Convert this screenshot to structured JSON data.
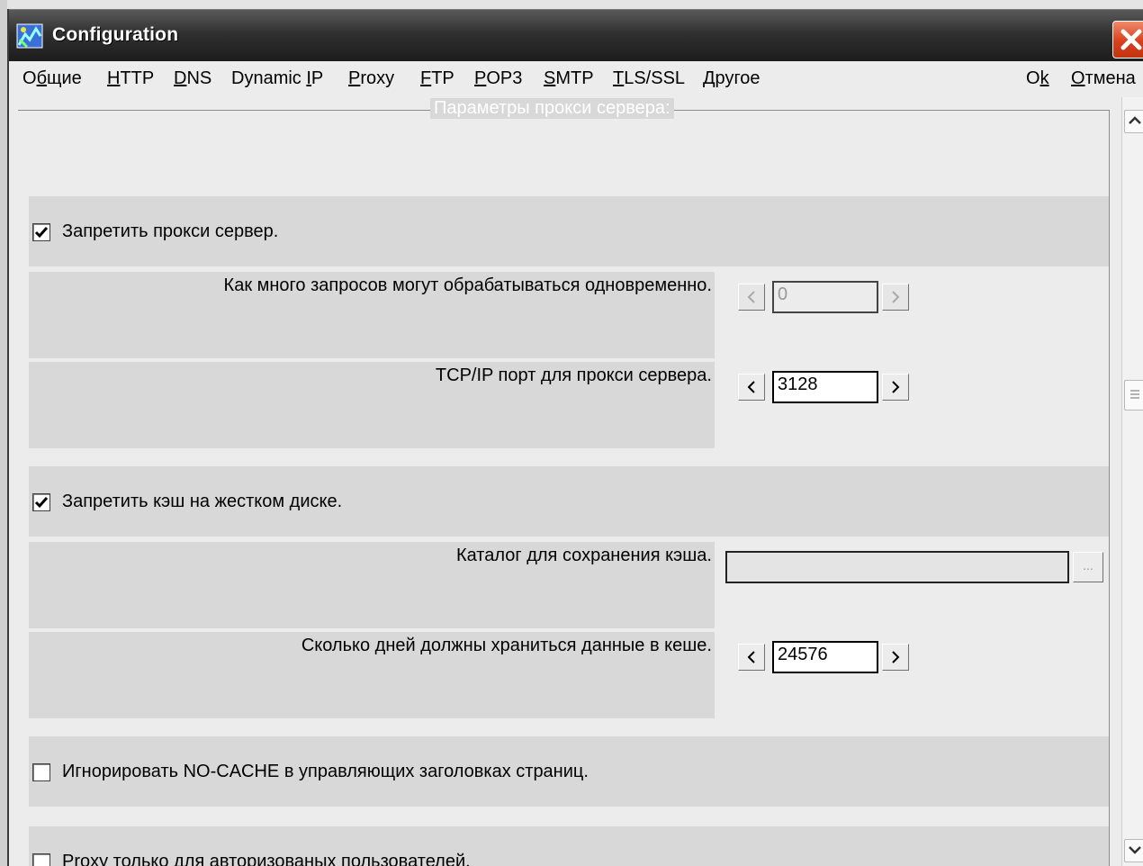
{
  "window": {
    "title": "Configuration",
    "icon": "config-app-icon",
    "close_icon": "close-icon"
  },
  "menu": {
    "items": [
      {
        "pre": "О",
        "key": "б",
        "post": "щие"
      },
      {
        "pre": "",
        "key": "H",
        "post": "TTP"
      },
      {
        "pre": "",
        "key": "D",
        "post": "NS"
      },
      {
        "pre": "Dynamic ",
        "key": "I",
        "post": "P"
      },
      {
        "pre": "",
        "key": "P",
        "post": "roxy"
      },
      {
        "pre": "",
        "key": "F",
        "post": "TP"
      },
      {
        "pre": "",
        "key": "P",
        "post": "OP3"
      },
      {
        "pre": "",
        "key": "S",
        "post": "MTP"
      },
      {
        "pre": "",
        "key": "T",
        "post": "LS/SSL"
      },
      {
        "pre": "",
        "key": "Д",
        "post": "ругое"
      }
    ],
    "ok": {
      "pre": "O",
      "key": "k",
      "post": ""
    },
    "cancel": {
      "pre": "",
      "key": "О",
      "post": "тмена"
    }
  },
  "group": {
    "title": "Параметры прокси сервера:"
  },
  "options": {
    "disable_proxy": {
      "label": "Запретить прокси сервер.",
      "checked": true
    },
    "concurrent_requests": {
      "label": "Как много запросов могут обрабатываться одновременно.",
      "value": "0",
      "enabled": false
    },
    "proxy_port": {
      "label": "TCP/IP порт для прокси сервера.",
      "value": "3128",
      "enabled": true
    },
    "disable_disk_cache": {
      "label": "Запретить  кэш на жестком диске.",
      "checked": true
    },
    "cache_dir": {
      "label": "Каталог для сохранения кэша.",
      "value": "",
      "browse_label": "..."
    },
    "cache_days": {
      "label": "Сколько дней должны храниться данные в кеше.",
      "value": "24576",
      "enabled": true
    },
    "ignore_nocache": {
      "label": "Игнорировать NO-CACHE в управляющих заголовках страниц.",
      "checked": false
    },
    "auth_only": {
      "label": "Proxy только для авторизованых пользователей.",
      "checked": false
    }
  },
  "scrollbar": {
    "up_icon": "chevron-up-icon",
    "down_icon": "chevron-down-icon",
    "thumb_icon": "grip-icon"
  }
}
